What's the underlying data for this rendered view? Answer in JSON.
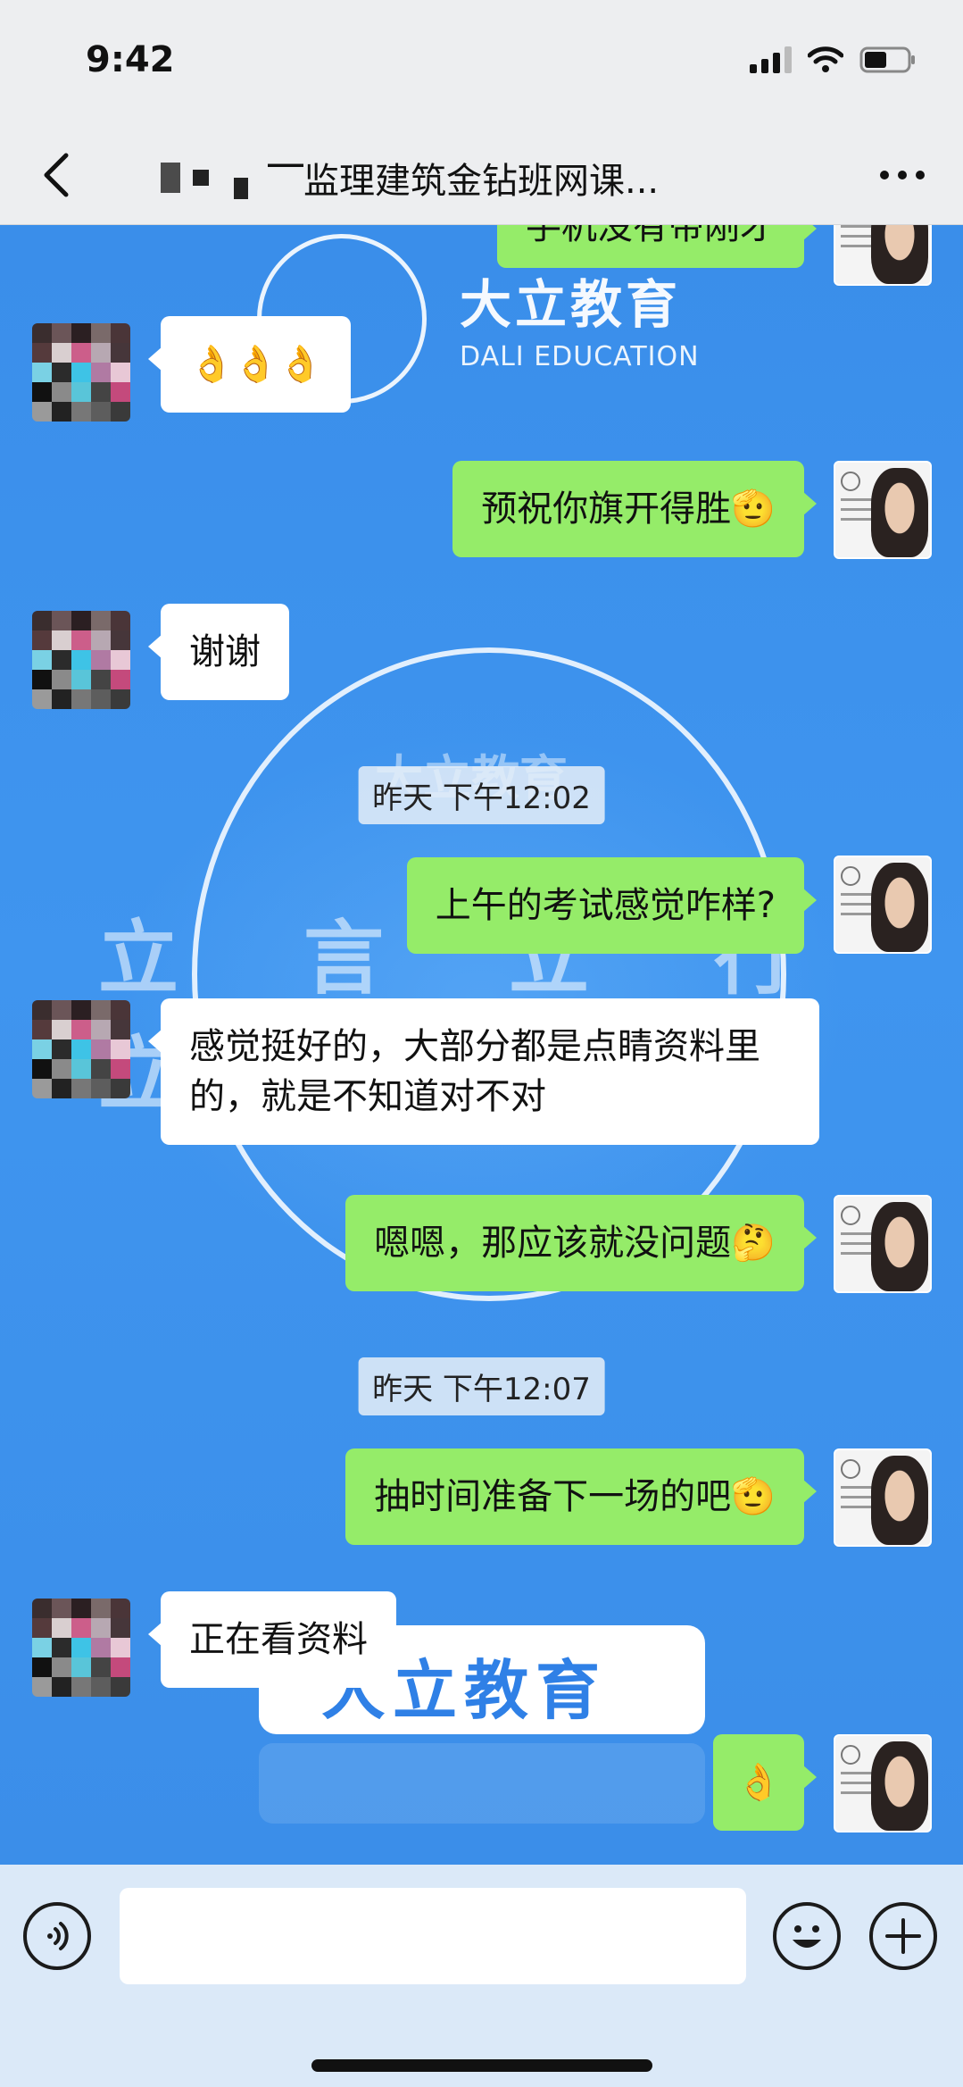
{
  "status_bar": {
    "time": "9:42"
  },
  "nav": {
    "title": "⎺监理建筑金钻班网课...",
    "back_icon": "chevron-left-icon",
    "more_icon": "ellipsis-icon"
  },
  "background": {
    "logo_text": "大立教育",
    "logo_sub": "DALI EDUCATION",
    "mid_text": "大立教育",
    "big_text": "立言立行立德",
    "banner_text": "大立教育"
  },
  "messages": [
    {
      "side": "out",
      "text": "手机没有带刚才"
    },
    {
      "side": "in",
      "text": "👌👌👌"
    },
    {
      "side": "out",
      "text": "预祝你旗开得胜🫡"
    },
    {
      "side": "in",
      "text": "谢谢"
    },
    {
      "side": "time",
      "text": "昨天 下午12:02"
    },
    {
      "side": "out",
      "text": "上午的考试感觉咋样?"
    },
    {
      "side": "in",
      "text": "感觉挺好的，大部分都是点睛资料里的，就是不知道对不对"
    },
    {
      "side": "out",
      "text": "嗯嗯，那应该就没问题🤔"
    },
    {
      "side": "time",
      "text": "昨天 下午12:07"
    },
    {
      "side": "out",
      "text": "抽时间准备下一场的吧🫡"
    },
    {
      "side": "in",
      "text": "正在看资料"
    },
    {
      "side": "out",
      "text": "👌"
    }
  ],
  "input_bar": {
    "placeholder": "",
    "voice_icon": "voice-icon",
    "emoji_icon": "smiley-icon",
    "plus_icon": "plus-icon"
  },
  "colors": {
    "bubble_out": "#95ec69",
    "bubble_in": "#ffffff",
    "chat_bg": "#3b90ec",
    "nav_bg": "#edeef0"
  }
}
